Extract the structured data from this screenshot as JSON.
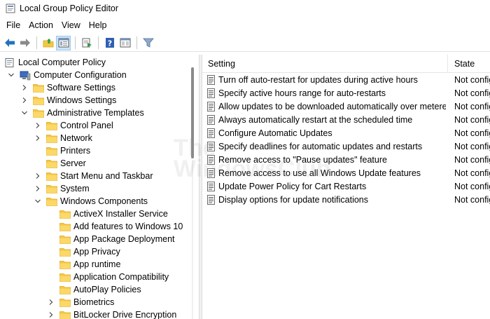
{
  "window": {
    "title": "Local Group Policy Editor"
  },
  "menu": [
    "File",
    "Action",
    "View",
    "Help"
  ],
  "toolbar": {
    "buttons": [
      "back-icon",
      "forward-icon",
      "up-folder-icon",
      "show-hide-tree-icon",
      "export-list-icon",
      "help-icon",
      "extended-view-icon",
      "filter-icon"
    ]
  },
  "tree": [
    {
      "label": "Local Computer Policy",
      "expanded": true,
      "chevron": "none",
      "icon": "computer-policy-icon"
    },
    {
      "label": "Computer Configuration",
      "expanded": true,
      "chevron": "down",
      "icon": "computer-icon"
    },
    {
      "label": "Software Settings",
      "chevron": "right",
      "icon": "folder-icon"
    },
    {
      "label": "Windows Settings",
      "chevron": "right",
      "icon": "folder-icon"
    },
    {
      "label": "Administrative Templates",
      "chevron": "down",
      "icon": "folder-icon"
    },
    {
      "label": "Control Panel",
      "chevron": "right",
      "icon": "folder-icon"
    },
    {
      "label": "Network",
      "chevron": "right",
      "icon": "folder-icon"
    },
    {
      "label": "Printers",
      "chevron": "none",
      "icon": "folder-icon"
    },
    {
      "label": "Server",
      "chevron": "none",
      "icon": "folder-icon"
    },
    {
      "label": "Start Menu and Taskbar",
      "chevron": "right",
      "icon": "folder-icon"
    },
    {
      "label": "System",
      "chevron": "right",
      "icon": "folder-icon"
    },
    {
      "label": "Windows Components",
      "chevron": "down",
      "icon": "folder-icon"
    },
    {
      "label": "ActiveX Installer Service",
      "chevron": "none",
      "icon": "folder-icon"
    },
    {
      "label": "Add features to Windows 10",
      "chevron": "none",
      "icon": "folder-icon"
    },
    {
      "label": "App Package Deployment",
      "chevron": "none",
      "icon": "folder-icon"
    },
    {
      "label": "App Privacy",
      "chevron": "none",
      "icon": "folder-icon"
    },
    {
      "label": "App runtime",
      "chevron": "none",
      "icon": "folder-icon"
    },
    {
      "label": "Application Compatibility",
      "chevron": "none",
      "icon": "folder-icon"
    },
    {
      "label": "AutoPlay Policies",
      "chevron": "none",
      "icon": "folder-icon"
    },
    {
      "label": "Biometrics",
      "chevron": "right",
      "icon": "folder-icon"
    },
    {
      "label": "BitLocker Drive Encryption",
      "chevron": "right",
      "icon": "folder-icon"
    }
  ],
  "list": {
    "columns": [
      "Setting",
      "State"
    ],
    "rows": [
      {
        "setting": "Turn off auto-restart for updates during active hours",
        "state": "Not configured"
      },
      {
        "setting": "Specify active hours range for auto-restarts",
        "state": "Not configured"
      },
      {
        "setting": "Allow updates to be downloaded automatically over metered connections",
        "state": "Not configured"
      },
      {
        "setting": "Always automatically restart at the scheduled time",
        "state": "Not configured"
      },
      {
        "setting": "Configure Automatic Updates",
        "state": "Not configured"
      },
      {
        "setting": "Specify deadlines for automatic updates and restarts",
        "state": "Not configured"
      },
      {
        "setting": "Remove access to \"Pause updates\" feature",
        "state": "Not configured"
      },
      {
        "setting": "Remove access to use all Windows Update features",
        "state": "Not configured"
      },
      {
        "setting": "Update Power Policy for Cart Restarts",
        "state": "Not configured"
      },
      {
        "setting": "Display options for update notifications",
        "state": "Not configured"
      }
    ]
  },
  "watermark": [
    "The",
    "WindowsClub"
  ],
  "colors": {
    "folder": "#f5c842",
    "folder_dark": "#e0a820",
    "selected_btn": "#cce4f7",
    "arrow_blue": "#1e73be",
    "help_blue": "#2f5fb3"
  }
}
